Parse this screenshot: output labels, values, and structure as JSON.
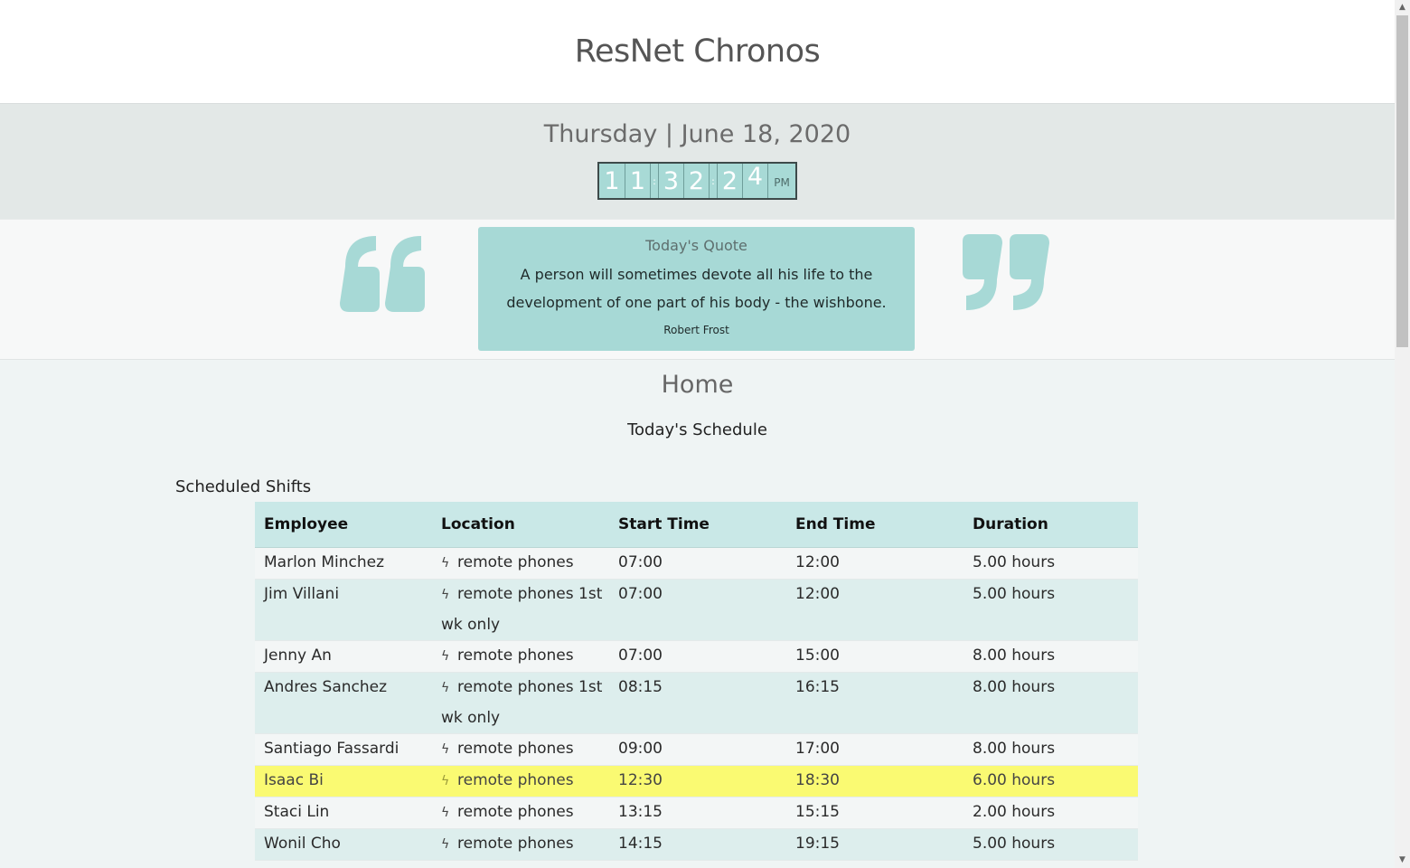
{
  "header": {
    "title": "ResNet Chronos"
  },
  "dateband": {
    "date": "Thursday | June 18, 2020",
    "clock": {
      "h1": "1",
      "h2": "1",
      "sep1": ":",
      "m1": "3",
      "m2": "2",
      "sep2": ":",
      "s1": "2",
      "s2": "4",
      "ampm": "PM"
    }
  },
  "quote": {
    "heading": "Today's Quote",
    "text": "A person will sometimes devote all his life to the development of one part of his body - the wishbone.",
    "author": "Robert Frost",
    "accent_color": "#a7d9d6"
  },
  "main": {
    "heading": "Home",
    "subheading": "Today's Schedule",
    "section_label": "Scheduled Shifts"
  },
  "table": {
    "headers": [
      "Employee",
      "Location",
      "Start Time",
      "End Time",
      "Duration"
    ],
    "location_icon": "bolt-icon",
    "rows": [
      {
        "employee": "Marlon Minchez",
        "location": "remote phones",
        "start": "07:00",
        "end": "12:00",
        "duration": "5.00 hours"
      },
      {
        "employee": "Jim Villani",
        "location": "remote phones 1st wk only",
        "start": "07:00",
        "end": "12:00",
        "duration": "5.00 hours"
      },
      {
        "employee": "Jenny An",
        "location": "remote phones",
        "start": "07:00",
        "end": "15:00",
        "duration": "8.00 hours"
      },
      {
        "employee": "Andres Sanchez",
        "location": "remote phones 1st wk only",
        "start": "08:15",
        "end": "16:15",
        "duration": "8.00 hours"
      },
      {
        "employee": "Santiago Fassardi",
        "location": "remote phones",
        "start": "09:00",
        "end": "17:00",
        "duration": "8.00 hours"
      },
      {
        "employee": "Isaac Bi",
        "location": "remote phones",
        "start": "12:30",
        "end": "18:30",
        "duration": "6.00 hours"
      },
      {
        "employee": "Staci Lin",
        "location": "remote phones",
        "start": "13:15",
        "end": "15:15",
        "duration": "2.00 hours"
      },
      {
        "employee": "Wonil Cho",
        "location": "remote phones",
        "start": "14:15",
        "end": "19:15",
        "duration": "5.00 hours"
      }
    ],
    "highlight_color": "#fafa72"
  }
}
